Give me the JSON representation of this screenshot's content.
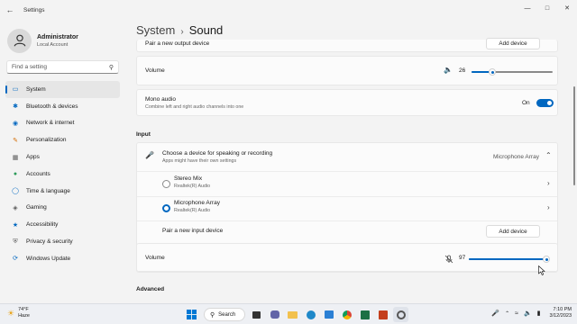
{
  "window": {
    "title": "Settings"
  },
  "profile": {
    "name": "Administrator",
    "account": "Local Account"
  },
  "search": {
    "placeholder": "Find a setting"
  },
  "nav": [
    {
      "label": "System",
      "icon": "monitor-icon",
      "color": "#0067c0",
      "active": true
    },
    {
      "label": "Bluetooth & devices",
      "icon": "bluetooth-icon",
      "color": "#0067c0"
    },
    {
      "label": "Network & internet",
      "icon": "wifi-icon",
      "color": "#0067c0"
    },
    {
      "label": "Personalization",
      "icon": "brush-icon",
      "color": "#d36b00"
    },
    {
      "label": "Apps",
      "icon": "apps-icon",
      "color": "#5a5a5a"
    },
    {
      "label": "Accounts",
      "icon": "person-icon",
      "color": "#2d9b5a"
    },
    {
      "label": "Time & language",
      "icon": "globe-clock-icon",
      "color": "#0067c0"
    },
    {
      "label": "Gaming",
      "icon": "gamepad-icon",
      "color": "#5a5a5a"
    },
    {
      "label": "Accessibility",
      "icon": "accessibility-icon",
      "color": "#0067c0"
    },
    {
      "label": "Privacy & security",
      "icon": "shield-icon",
      "color": "#5a5a5a"
    },
    {
      "label": "Windows Update",
      "icon": "update-icon",
      "color": "#0067c0"
    }
  ],
  "header": {
    "crumb": "System",
    "separator": "›",
    "title": "Sound"
  },
  "output": {
    "pair_label": "Pair a new output device",
    "add_button": "Add device",
    "volume_label": "Volume",
    "volume_value": "26",
    "volume_fraction": 0.26
  },
  "mono": {
    "label": "Mono audio",
    "desc": "Combine left and right audio channels into one",
    "state": "On",
    "on": true
  },
  "input": {
    "section": "Input",
    "choose_label": "Choose a device for speaking or recording",
    "choose_desc": "Apps might have their own settings",
    "selected": "Microphone Array",
    "devices": [
      {
        "name": "Stereo Mix",
        "driver": "Realtek(R) Audio",
        "checked": false
      },
      {
        "name": "Microphone Array",
        "driver": "Realtek(R) Audio",
        "checked": true
      }
    ],
    "pair_label": "Pair a new input device",
    "add_button": "Add device",
    "volume_label": "Volume",
    "volume_value": "97",
    "volume_fraction": 0.97
  },
  "advanced": {
    "section": "Advanced"
  },
  "taskbar": {
    "temp": "74°F",
    "weather": "Haze",
    "search_label": "Search",
    "time": "7:10 PM",
    "date": "3/12/2023"
  }
}
